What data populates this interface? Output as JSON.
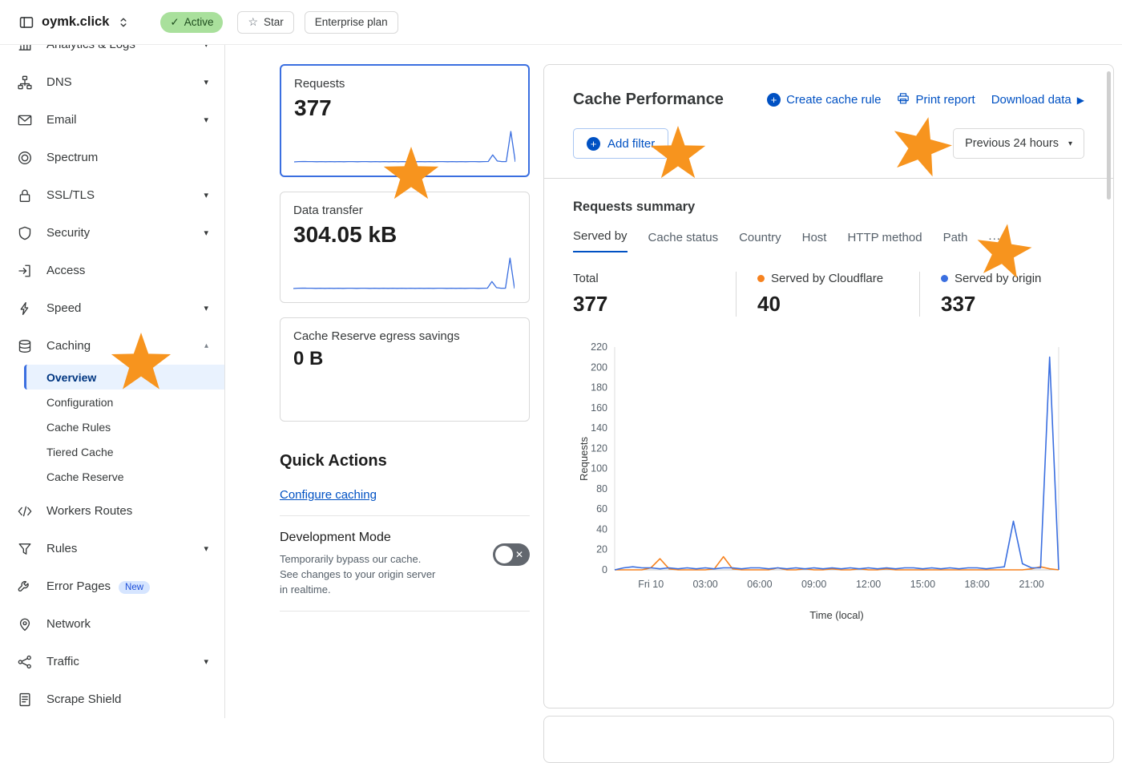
{
  "header": {
    "site_name": "oymk.click",
    "status_badge": "Active",
    "star_label": "Star",
    "plan_label": "Enterprise plan"
  },
  "icons": {
    "chevron_down": "▾",
    "chevron_up": "▴",
    "star_outline": "☆",
    "check": "✓",
    "close": "✕",
    "play": "▶",
    "plus": "+",
    "caret": "▾",
    "ellipsis": "..."
  },
  "sidebar": {
    "items": [
      {
        "label": "Analytics & Logs"
      },
      {
        "label": "DNS"
      },
      {
        "label": "Email"
      },
      {
        "label": "Spectrum"
      },
      {
        "label": "SSL/TLS"
      },
      {
        "label": "Security"
      },
      {
        "label": "Access"
      },
      {
        "label": "Speed"
      },
      {
        "label": "Caching"
      },
      {
        "label": "Overview"
      },
      {
        "label": "Configuration"
      },
      {
        "label": "Cache Rules"
      },
      {
        "label": "Tiered Cache"
      },
      {
        "label": "Cache Reserve"
      },
      {
        "label": "Workers Routes"
      },
      {
        "label": "Rules"
      },
      {
        "label": "Error Pages"
      },
      {
        "label": "Network"
      },
      {
        "label": "Traffic"
      },
      {
        "label": "Scrape Shield"
      }
    ],
    "new_badge": "New"
  },
  "cards": [
    {
      "title": "Requests",
      "value": "377"
    },
    {
      "title": "Data transfer",
      "value": "304.05 kB"
    },
    {
      "title": "Cache Reserve egress savings",
      "value": "0 B"
    }
  ],
  "quick_actions": {
    "title": "Quick Actions",
    "configure_link": "Configure caching",
    "dev_mode": {
      "title": "Development Mode",
      "description": "Temporarily bypass our cache. See changes to your origin server in realtime."
    }
  },
  "cache_performance": {
    "title": "Cache Performance",
    "create_rule": "Create cache rule",
    "print_report": "Print report",
    "download_data": "Download data",
    "add_filter": "Add filter",
    "time_range": "Previous 24 hours",
    "summary_title": "Requests summary",
    "tabs": [
      "Served by",
      "Cache status",
      "Country",
      "Host",
      "HTTP method",
      "Path"
    ],
    "stats": [
      {
        "label": "Total",
        "value": "377"
      },
      {
        "label": "Served by Cloudflare",
        "value": "40"
      },
      {
        "label": "Served by origin",
        "value": "337"
      }
    ]
  },
  "colors": {
    "accent_blue": "#0051c3",
    "chart_blue": "#3b6fe0",
    "chart_orange": "#f6821f",
    "star_orange": "#f7941e"
  },
  "chart_data": {
    "type": "line",
    "title": "Requests summary — Served by",
    "xlabel": "Time (local)",
    "ylabel": "Requests",
    "ylim": [
      0,
      220
    ],
    "yticks": [
      0,
      20,
      40,
      60,
      80,
      100,
      120,
      140,
      160,
      180,
      200,
      220
    ],
    "x_range": [
      -2,
      22.5
    ],
    "x_ticks": [
      0,
      3,
      6,
      9,
      12,
      15,
      18,
      21
    ],
    "x_tick_labels": [
      "Fri 10",
      "03:00",
      "06:00",
      "09:00",
      "12:00",
      "15:00",
      "18:00",
      "21:00"
    ],
    "x": [
      -2,
      -1.5,
      -1,
      -0.5,
      0,
      0.5,
      1,
      1.5,
      2,
      2.5,
      3,
      3.5,
      4,
      4.5,
      5,
      5.5,
      6,
      6.5,
      7,
      7.5,
      8,
      8.5,
      9,
      9.5,
      10,
      10.5,
      11,
      11.5,
      12,
      12.5,
      13,
      13.5,
      14,
      14.5,
      15,
      15.5,
      16,
      16.5,
      17,
      17.5,
      18,
      18.5,
      19,
      19.5,
      20,
      20.5,
      21,
      21.5,
      22,
      22.5
    ],
    "series": [
      {
        "name": "Served by Cloudflare",
        "color": "#f6821f",
        "total": 40,
        "values": [
          0,
          0,
          0,
          0,
          2,
          11,
          1,
          0,
          0,
          0,
          0,
          1,
          13,
          1,
          0,
          0,
          0,
          0,
          2,
          0,
          0,
          1,
          0,
          0,
          1,
          0,
          0,
          1,
          0,
          0,
          1,
          0,
          0,
          0,
          0,
          0,
          0,
          0,
          0,
          0,
          0,
          0,
          0,
          0,
          0,
          0,
          1,
          3,
          1,
          0
        ]
      },
      {
        "name": "Served by origin",
        "color": "#3b6fe0",
        "total": 337,
        "values": [
          0,
          2,
          3,
          2,
          2,
          1,
          2,
          1,
          2,
          1,
          2,
          1,
          2,
          2,
          1,
          2,
          2,
          1,
          2,
          1,
          2,
          1,
          2,
          1,
          2,
          1,
          2,
          1,
          2,
          1,
          2,
          1,
          2,
          2,
          1,
          2,
          1,
          2,
          1,
          2,
          2,
          1,
          2,
          3,
          48,
          6,
          2,
          2,
          210,
          0
        ]
      }
    ],
    "legend_position": "top",
    "grid": false
  }
}
